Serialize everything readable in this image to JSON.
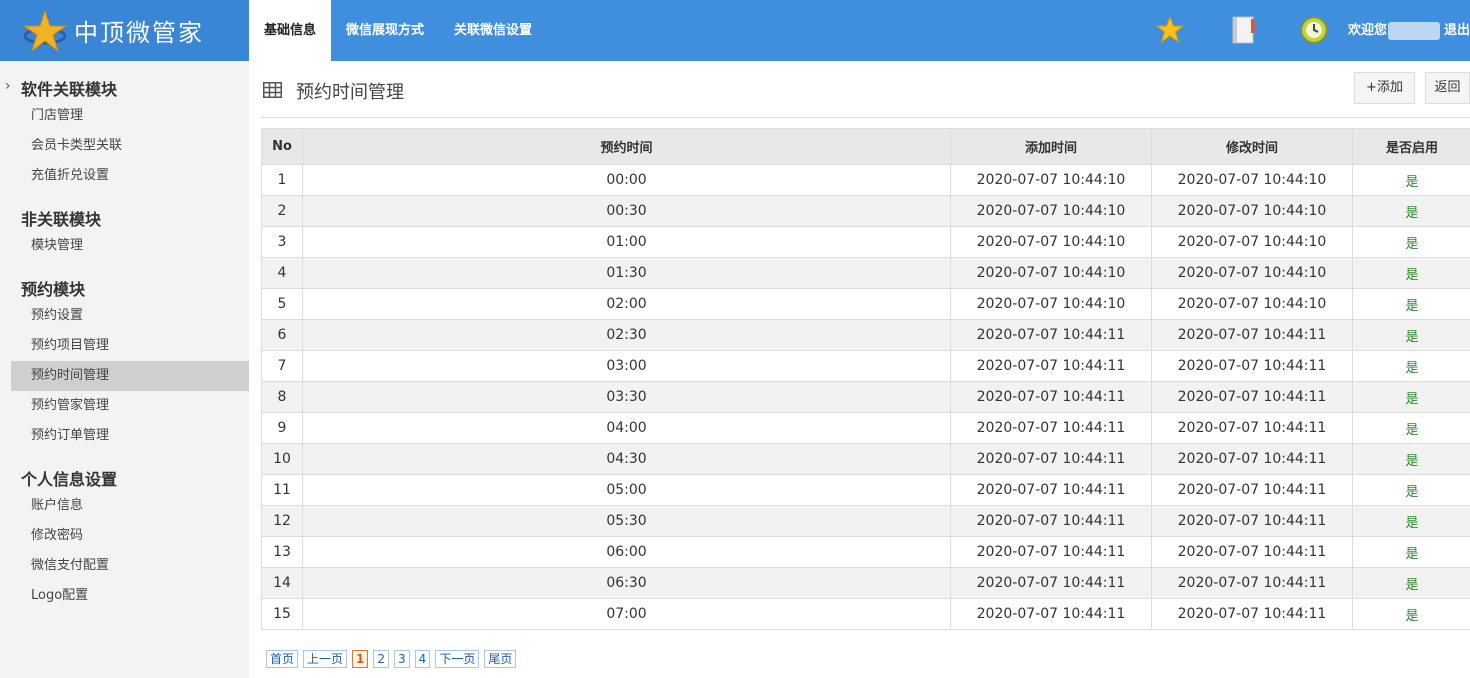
{
  "app": {
    "logo_text": "中顶微管家",
    "nav_tabs": [
      "基础信息",
      "微信展现方式",
      "关联微信设置"
    ],
    "welcome_text": "欢迎您",
    "logout_label": "退出"
  },
  "sidebar": {
    "sections": [
      {
        "title": "软件关联模块",
        "items": [
          "门店管理",
          "会员卡类型关联",
          "充值折兑设置"
        ]
      },
      {
        "title": "非关联模块",
        "items": [
          "模块管理"
        ]
      },
      {
        "title": "预约模块",
        "items": [
          "预约设置",
          "预约项目管理",
          "预约时间管理",
          "预约管家管理",
          "预约订单管理"
        ]
      },
      {
        "title": "个人信息设置",
        "items": [
          "账户信息",
          "修改密码",
          "微信支付配置",
          "Logo配置"
        ]
      }
    ],
    "active_item": "预约时间管理"
  },
  "main": {
    "title": "预约时间管理",
    "add_button": "+添加",
    "back_button": "返回",
    "columns": [
      "No",
      "预约时间",
      "添加时间",
      "修改时间",
      "是否启用"
    ],
    "rows": [
      [
        "1",
        "00:00",
        "2020-07-07 10:44:10",
        "2020-07-07 10:44:10",
        "是"
      ],
      [
        "2",
        "00:30",
        "2020-07-07 10:44:10",
        "2020-07-07 10:44:10",
        "是"
      ],
      [
        "3",
        "01:00",
        "2020-07-07 10:44:10",
        "2020-07-07 10:44:10",
        "是"
      ],
      [
        "4",
        "01:30",
        "2020-07-07 10:44:10",
        "2020-07-07 10:44:10",
        "是"
      ],
      [
        "5",
        "02:00",
        "2020-07-07 10:44:10",
        "2020-07-07 10:44:10",
        "是"
      ],
      [
        "6",
        "02:30",
        "2020-07-07 10:44:11",
        "2020-07-07 10:44:11",
        "是"
      ],
      [
        "7",
        "03:00",
        "2020-07-07 10:44:11",
        "2020-07-07 10:44:11",
        "是"
      ],
      [
        "8",
        "03:30",
        "2020-07-07 10:44:11",
        "2020-07-07 10:44:11",
        "是"
      ],
      [
        "9",
        "04:00",
        "2020-07-07 10:44:11",
        "2020-07-07 10:44:11",
        "是"
      ],
      [
        "10",
        "04:30",
        "2020-07-07 10:44:11",
        "2020-07-07 10:44:11",
        "是"
      ],
      [
        "11",
        "05:00",
        "2020-07-07 10:44:11",
        "2020-07-07 10:44:11",
        "是"
      ],
      [
        "12",
        "05:30",
        "2020-07-07 10:44:11",
        "2020-07-07 10:44:11",
        "是"
      ],
      [
        "13",
        "06:00",
        "2020-07-07 10:44:11",
        "2020-07-07 10:44:11",
        "是"
      ],
      [
        "14",
        "06:30",
        "2020-07-07 10:44:11",
        "2020-07-07 10:44:11",
        "是"
      ],
      [
        "15",
        "07:00",
        "2020-07-07 10:44:11",
        "2020-07-07 10:44:11",
        "是"
      ]
    ],
    "pager": [
      "首页",
      "上一页",
      "1",
      "2",
      "3",
      "4",
      "下一页",
      "尾页"
    ],
    "current_page": "1"
  },
  "colors": {
    "topbar": "#3f8fde",
    "enabled_text": "#2a8a2a",
    "pager_current": "#e05a00"
  },
  "icons": [
    "logo-star-icon",
    "star-icon",
    "notebook-icon",
    "clock-icon",
    "table-grid-icon",
    "chevron-right-icon"
  ]
}
